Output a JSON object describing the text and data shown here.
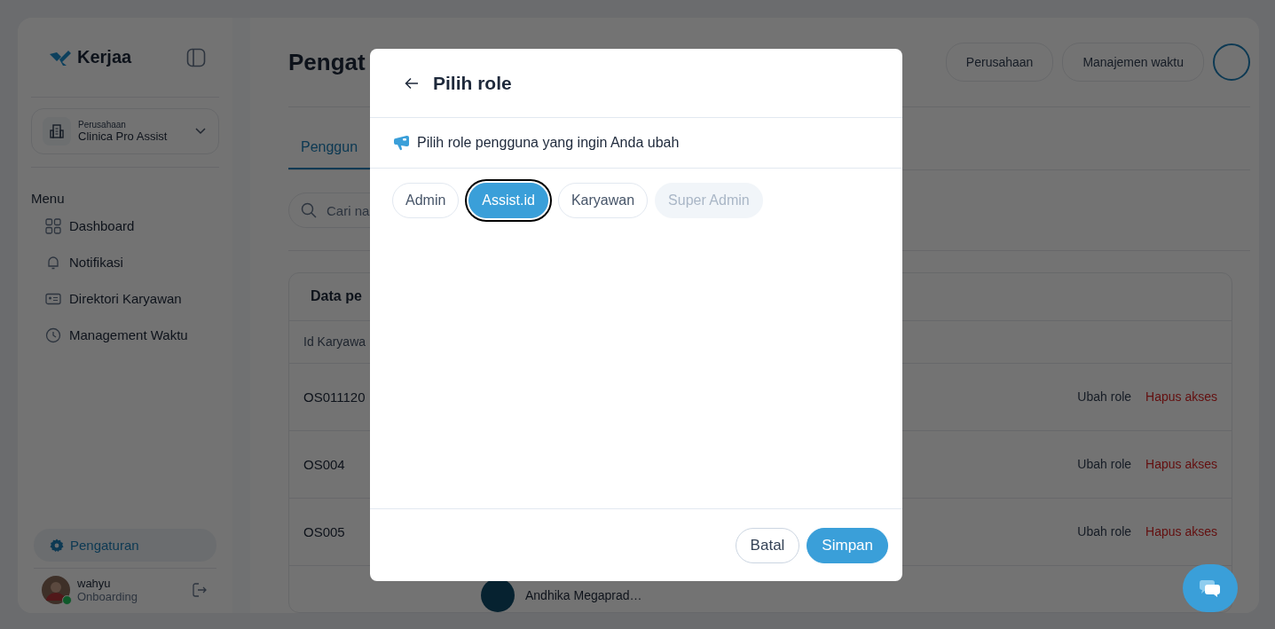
{
  "sidebar": {
    "brand": "Kerjaa",
    "company": {
      "label": "Perusahaan",
      "name": "Clinica Pro Assist"
    },
    "menu_title": "Menu",
    "items": [
      {
        "label": "Dashboard"
      },
      {
        "label": "Notifikasi"
      },
      {
        "label": "Direktori Karyawan"
      },
      {
        "label": "Management Waktu"
      }
    ],
    "settings": {
      "label": "Pengaturan",
      "selected": true
    },
    "user": {
      "name": "wahyu",
      "status": "Onboarding",
      "online": true
    }
  },
  "header": {
    "title": "Pengat",
    "nav": [
      {
        "label": "Perusahaan"
      },
      {
        "label": "Manajemen waktu"
      }
    ]
  },
  "tabs": [
    {
      "label": "Penggun",
      "selected": true
    }
  ],
  "search": {
    "placeholder": "Cari na"
  },
  "table": {
    "title": "Data pe",
    "columns": [
      "Id Karyawa"
    ],
    "rows": [
      {
        "id": "OS011120",
        "edit": "Ubah role",
        "remove": "Hapus akses"
      },
      {
        "id": "OS004",
        "edit": "Ubah role",
        "remove": "Hapus akses"
      },
      {
        "id": "OS005",
        "edit": "Ubah role",
        "remove": "Hapus akses"
      }
    ],
    "partial_row": {
      "name": "Andhika Megaprad…"
    }
  },
  "dialog": {
    "title": "Pilih role",
    "hint": "Pilih role pengguna yang ingin Anda ubah",
    "roles": [
      {
        "label": "Admin",
        "selected": false,
        "disabled": false
      },
      {
        "label": "Assist.id",
        "selected": true,
        "disabled": false
      },
      {
        "label": "Karyawan",
        "selected": false,
        "disabled": false
      },
      {
        "label": "Super Admin",
        "selected": false,
        "disabled": true
      }
    ],
    "buttons": [
      {
        "label": "Batal",
        "kind": "secondary"
      },
      {
        "label": "Simpan",
        "kind": "primary"
      }
    ]
  }
}
